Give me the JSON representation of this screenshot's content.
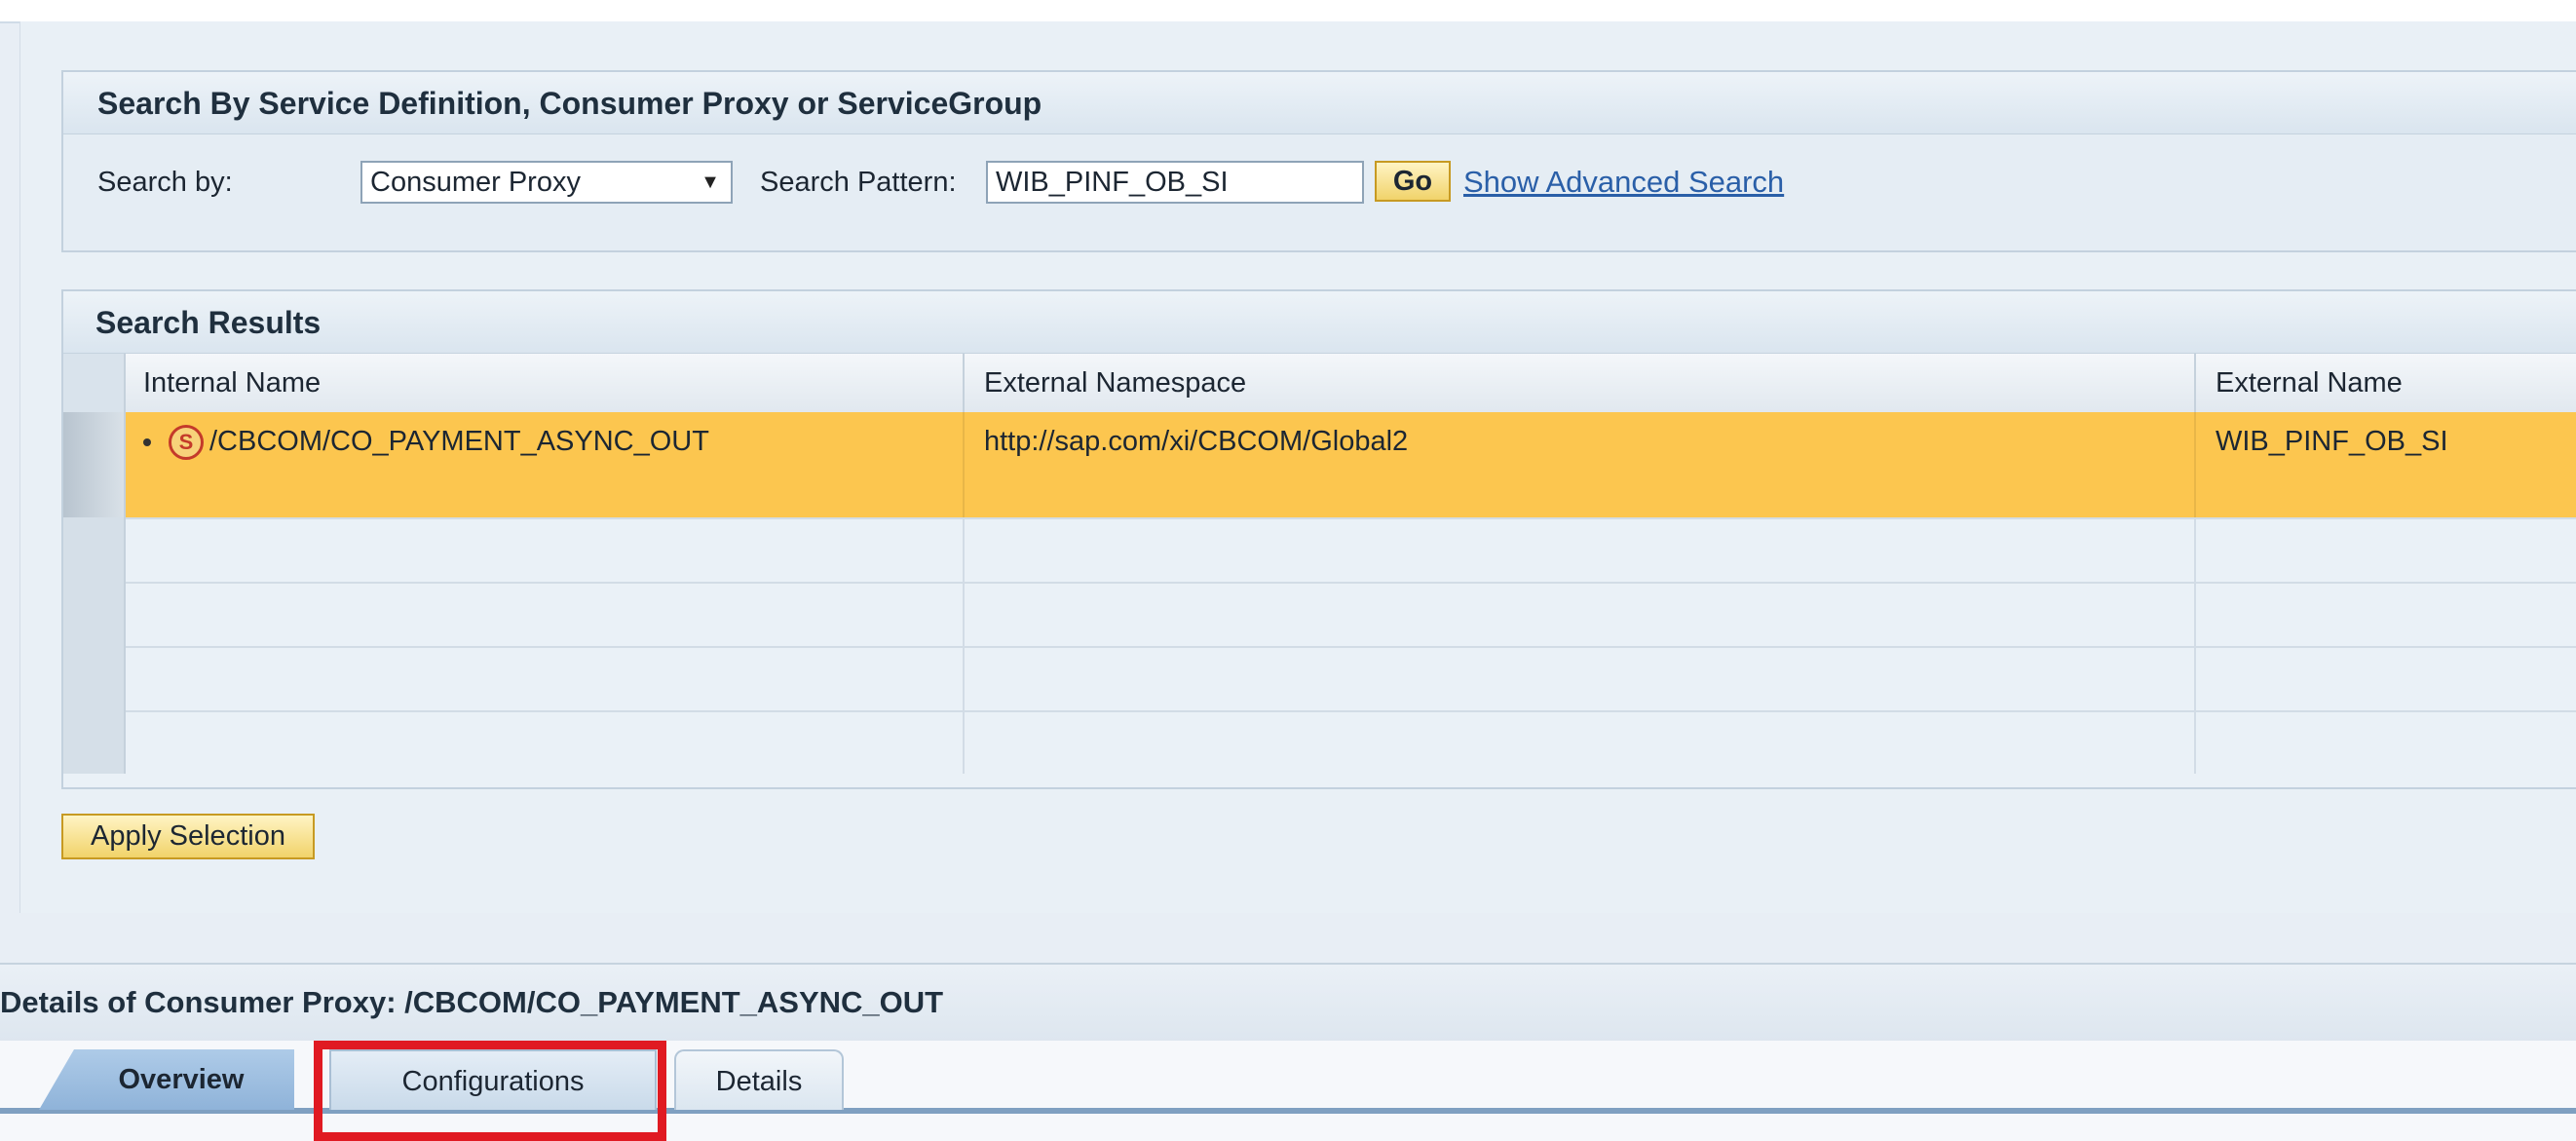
{
  "search": {
    "box_title": "Search By Service Definition, Consumer Proxy or ServiceGroup",
    "search_by_label": "Search by:",
    "search_by_value": "Consumer Proxy",
    "pattern_label": "Search Pattern:",
    "pattern_value": "WIB_PINF_OB_SI",
    "go_label": "Go",
    "advanced_link": "Show Advanced Search"
  },
  "results": {
    "title": "Search Results",
    "columns": [
      "Internal Name",
      "External Namespace",
      "External Name"
    ],
    "rows": [
      {
        "internal_name": "/CBCOM/CO_PAYMENT_ASYNC_OUT",
        "external_namespace": "http://sap.com/xi/CBCOM/Global2",
        "external_name": "WIB_PINF_OB_SI",
        "icon": "service-s-icon",
        "selected": true
      }
    ],
    "apply_label": "Apply Selection"
  },
  "details": {
    "title": "Details of Consumer Proxy: /CBCOM/CO_PAYMENT_ASYNC_OUT",
    "tabs": [
      "Overview",
      "Configurations",
      "Details"
    ],
    "active_tab": "Overview",
    "highlighted_tab": "Configurations"
  },
  "colors": {
    "selected_row": "#fcc64f",
    "highlight_box": "#e01a22",
    "link": "#2a5fa8"
  }
}
